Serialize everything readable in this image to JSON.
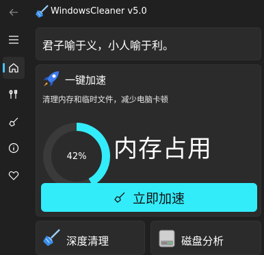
{
  "app": {
    "title": "WindowsCleaner v5.0"
  },
  "nav": {
    "back_icon": "back-arrow-icon",
    "menu_icon": "hamburger-menu-icon",
    "items": [
      {
        "icon": "home-icon",
        "active": true
      },
      {
        "icon": "tools-icon",
        "active": false
      },
      {
        "icon": "broom-icon",
        "active": false
      },
      {
        "icon": "info-icon",
        "active": false
      },
      {
        "icon": "heart-icon",
        "active": false
      }
    ]
  },
  "motto": "君子喻于义，小人喻于利。",
  "boost": {
    "title": "一键加速",
    "description": "清理内存和临时文件，减少电脑卡顿",
    "memory_percent": 42,
    "memory_percent_label": "42%",
    "memory_label": "内存占用",
    "button_label": "立即加速"
  },
  "cards": {
    "deep_clean": "深度清理",
    "disk_analysis": "磁盘分析"
  },
  "colors": {
    "accent": "#33ecfa",
    "background": "#202020",
    "card": "#2b2b2b",
    "gauge_track": "#3a3a3a"
  }
}
